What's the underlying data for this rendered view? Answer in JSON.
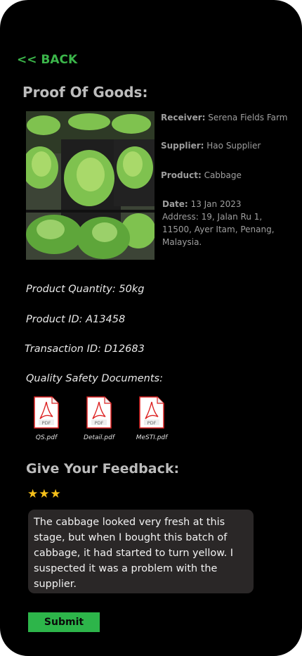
{
  "nav": {
    "back_label": "<< BACK"
  },
  "page": {
    "title": "Proof Of Goods:"
  },
  "info": {
    "receiver_label": "Receiver:",
    "receiver_value": "Serena Fields Farm",
    "supplier_label": "Supplier:",
    "supplier_value": "Hao Supplier",
    "product_label": "Product:",
    "product_value": "Cabbage",
    "date_label": "Date:",
    "date_value": "13 Jan 2023",
    "address_line1": "Address: 19, Jalan Ru 1,",
    "address_line2": "11500, Ayer Itam, Penang,",
    "address_line3": "Malaysia."
  },
  "details": {
    "quantity": "Product Quantity: 50kg",
    "product_id": "Product ID: A13458",
    "transaction_id": "Transaction ID: D12683",
    "docs_heading": "Quality Safety Documents:"
  },
  "documents": [
    {
      "name": "QS.pdf",
      "badge": "PDF"
    },
    {
      "name": "Detail.pdf",
      "badge": "PDF"
    },
    {
      "name": "MeSTI.pdf",
      "badge": "PDF"
    }
  ],
  "feedback": {
    "title": "Give Your Feedback:",
    "rating": 3,
    "star_icon": "star-icon",
    "comment": "The cabbage looked very fresh at this stage, but when I bought this batch of cabbage, it had started to turn yellow. I suspected it was a problem with the supplier.",
    "submit_label": "Submit"
  },
  "colors": {
    "accent": "#2db54a",
    "star": "#f6c01a",
    "background": "#000000"
  }
}
